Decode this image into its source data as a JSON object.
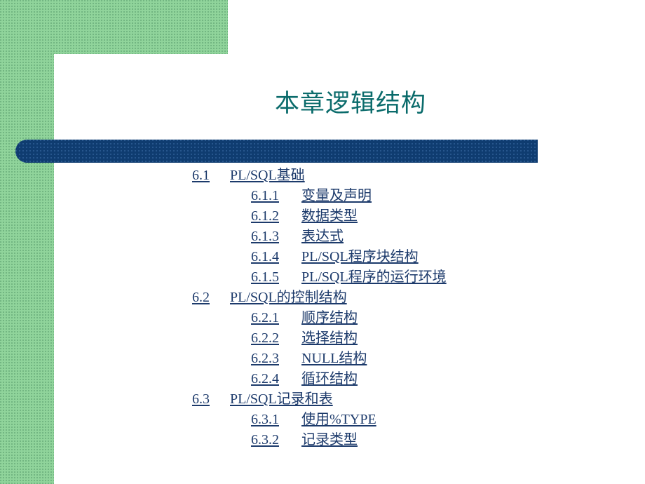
{
  "slide": {
    "title": "本章逻辑结构",
    "title_color": "#0a6b6b",
    "accent_green": "#90d49b",
    "accent_navy": "#0f3c70",
    "text_color": "#1c3a6b",
    "background": "#ffffff"
  },
  "toc": {
    "entries": [
      {
        "level": 1,
        "number": "6.1",
        "label": "PL/SQL基础"
      },
      {
        "level": 2,
        "number": "6.1.1",
        "label": "变量及声明"
      },
      {
        "level": 2,
        "number": "6.1.2",
        "label": "数据类型"
      },
      {
        "level": 2,
        "number": "6.1.3",
        "label": "表达式"
      },
      {
        "level": 2,
        "number": "6.1.4",
        "label": "PL/SQL程序块结构"
      },
      {
        "level": 2,
        "number": "6.1.5",
        "label": "PL/SQL程序的运行环境"
      },
      {
        "level": 1,
        "number": "6.2",
        "label": "PL/SQL的控制结构"
      },
      {
        "level": 2,
        "number": "6.2.1",
        "label": "顺序结构"
      },
      {
        "level": 2,
        "number": "6.2.2",
        "label": "选择结构"
      },
      {
        "level": 2,
        "number": "6.2.3",
        "label": "NULL结构"
      },
      {
        "level": 2,
        "number": "6.2.4",
        "label": "循环结构"
      },
      {
        "level": 1,
        "number": "6.3",
        "label": "PL/SQL记录和表"
      },
      {
        "level": 2,
        "number": "6.3.1",
        "label": "使用%TYPE"
      },
      {
        "level": 2,
        "number": "6.3.2",
        "label": "记录类型"
      }
    ]
  }
}
